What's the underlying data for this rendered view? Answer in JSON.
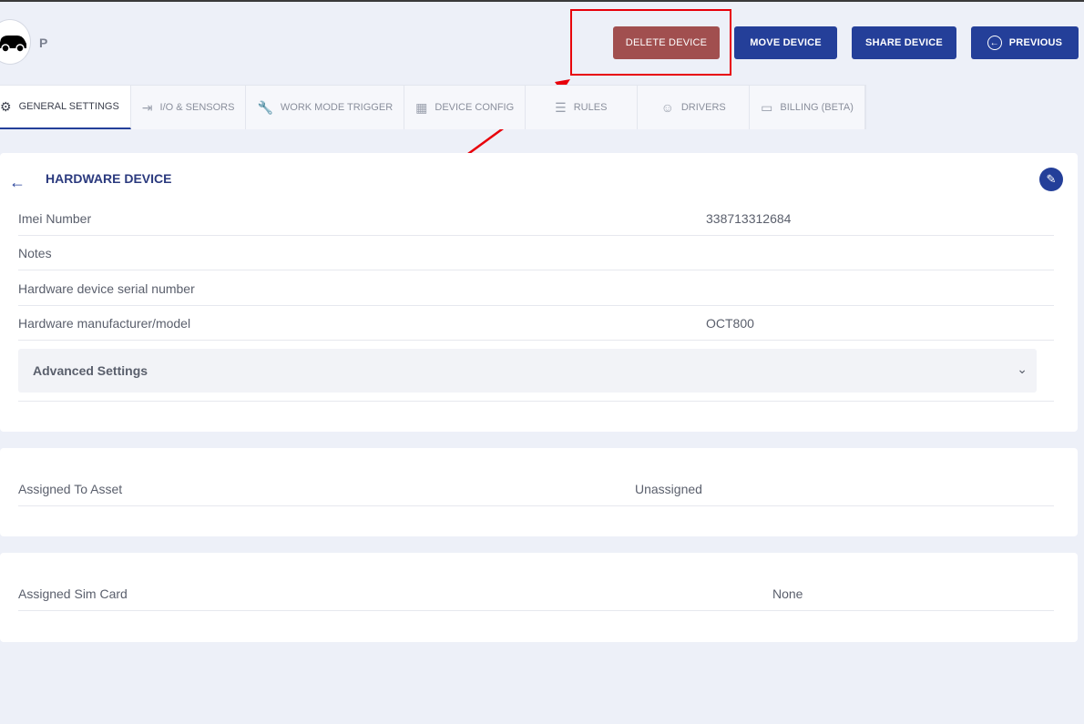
{
  "header": {
    "device_name": "P",
    "buttons": {
      "delete": "DELETE DEVICE",
      "move": "MOVE DEVICE",
      "share": "SHARE DEVICE",
      "previous": "PREVIOUS"
    }
  },
  "tabs": [
    {
      "label": "GENERAL SETTINGS",
      "icon": "gear-icon",
      "active": true
    },
    {
      "label": "I/O & SENSORS",
      "icon": "sign-in-icon"
    },
    {
      "label": "WORK MODE TRIGGER",
      "icon": "wrench-icon"
    },
    {
      "label": "DEVICE CONFIG",
      "icon": "table-icon"
    },
    {
      "label": "RULES",
      "icon": "list-icon"
    },
    {
      "label": "DRIVERS",
      "icon": "user-icon"
    },
    {
      "label": "BILLING (BETA)",
      "icon": "wallet-icon"
    }
  ],
  "hardware": {
    "title": "HARDWARE DEVICE",
    "rows": [
      {
        "label": "Imei Number",
        "value": "338713312684"
      },
      {
        "label": "Notes",
        "value": ""
      },
      {
        "label": "Hardware device serial number",
        "value": ""
      },
      {
        "label": "Hardware manufacturer/model",
        "value": "OCT800"
      }
    ],
    "advanced": "Advanced Settings"
  },
  "asset": {
    "label": "Assigned To Asset",
    "value": "Unassigned"
  },
  "sim": {
    "label": "Assigned Sim Card",
    "value": "None"
  },
  "colors": {
    "primary": "#243f99",
    "delete": "#a14f4f",
    "highlight": "#e8000a",
    "background": "#edf0f8"
  }
}
